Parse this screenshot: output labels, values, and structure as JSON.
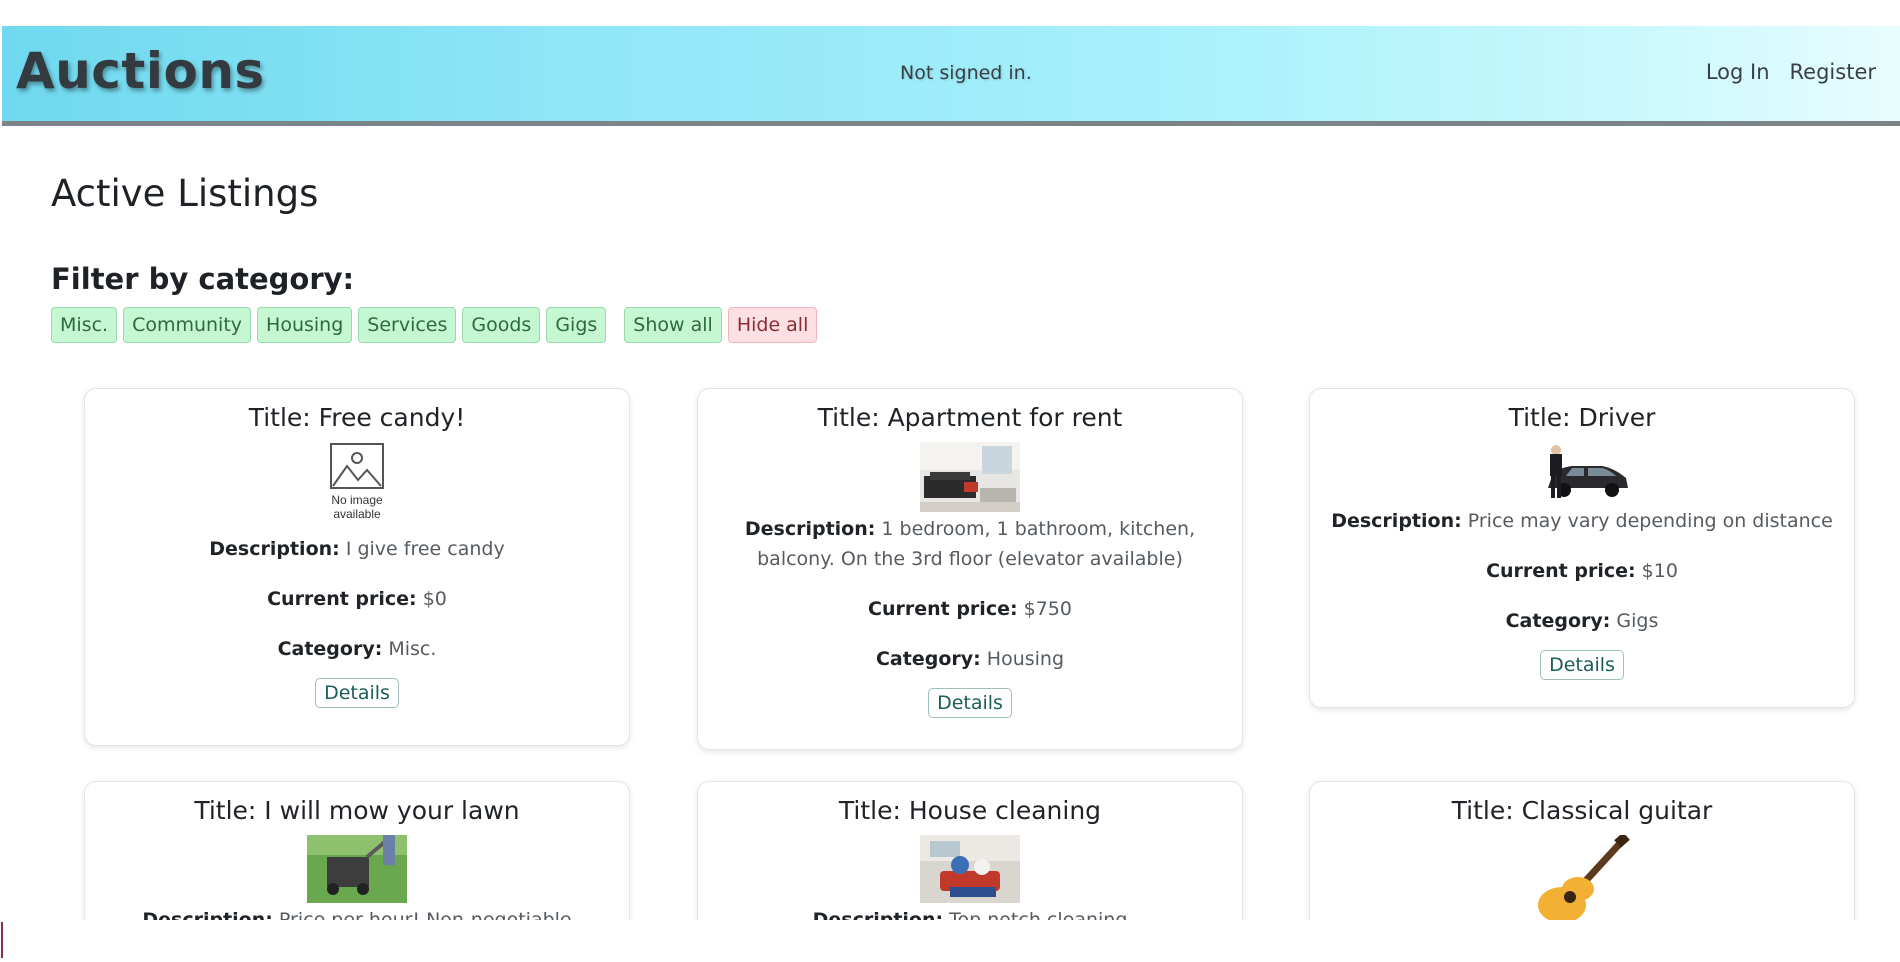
{
  "navbar": {
    "brand": "Auctions",
    "status": "Not signed in.",
    "links": [
      {
        "label": "Log In"
      },
      {
        "label": "Register"
      }
    ]
  },
  "page": {
    "title": "Active Listings",
    "filter_label": "Filter by category:"
  },
  "filters": [
    {
      "label": "Misc."
    },
    {
      "label": "Community"
    },
    {
      "label": "Housing"
    },
    {
      "label": "Services"
    },
    {
      "label": "Goods"
    },
    {
      "label": "Gigs"
    },
    {
      "label": "Show all"
    },
    {
      "label": "Hide all"
    }
  ],
  "labels": {
    "description": "Description:",
    "price": "Current price:",
    "category": "Category:",
    "details": "Details",
    "no_image": "No image available"
  },
  "listings": [
    {
      "title": "Title: Free candy!",
      "description": "I give free candy",
      "price": "$0",
      "category": "Misc.",
      "image": "no-image"
    },
    {
      "title": "Title: Apartment for rent",
      "description": "1 bedroom, 1 bathroom, kitchen, balcony. On the 3rd floor (elevator available)",
      "price": "$750",
      "category": "Housing",
      "image": "apartment-photo"
    },
    {
      "title": "Title: Driver",
      "description": "Price may vary depending on distance",
      "price": "$10",
      "category": "Gigs",
      "image": "driver-car-photo"
    },
    {
      "title": "Title: I will mow your lawn",
      "description": "Price per hour! Non-negotiable",
      "image": "lawn-mower-photo"
    },
    {
      "title": "Title: House cleaning",
      "description": "Top notch cleaning",
      "image": "cleaning-photo"
    },
    {
      "title": "Title: Classical guitar",
      "image": "guitar-photo"
    }
  ]
}
